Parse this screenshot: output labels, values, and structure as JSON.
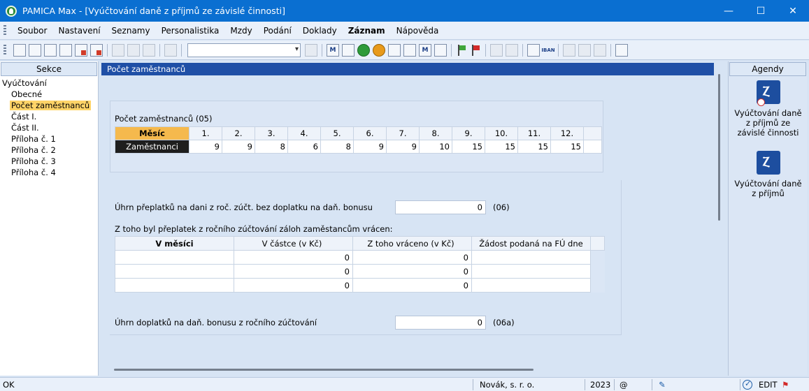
{
  "window": {
    "title": "PAMICA Max - [Vyúčtování daně z příjmů ze závislé činnosti]",
    "minimize": "—",
    "maximize": "☐",
    "close": "✕"
  },
  "menu": [
    {
      "label": "Soubor"
    },
    {
      "label": "Nastavení"
    },
    {
      "label": "Seznamy"
    },
    {
      "label": "Personalistika"
    },
    {
      "label": "Mzdy"
    },
    {
      "label": "Podání"
    },
    {
      "label": "Doklady"
    },
    {
      "label": "Záznam"
    },
    {
      "label": "Nápověda"
    }
  ],
  "toolbar": {
    "iban_label": "IBAN",
    "combo_value": ""
  },
  "left_panel": {
    "header": "Sekce",
    "items": [
      "Vyúčtování",
      "Obecné",
      "Počet zaměstnanců",
      "Část I.",
      "Část II.",
      "Příloha č. 1",
      "Příloha č. 2",
      "Příloha č. 3",
      "Příloha č. 4"
    ],
    "selected_index": 2
  },
  "main": {
    "header": "Počet zaměstnanců",
    "employees_label": "Počet zaměstnanců (05)",
    "month_header": "Měsíc",
    "months": [
      "1.",
      "2.",
      "3.",
      "4.",
      "5.",
      "6.",
      "7.",
      "8.",
      "9.",
      "10.",
      "11.",
      "12."
    ],
    "row_label": "Zaměstnanci",
    "employee_counts": [
      "9",
      "9",
      "8",
      "6",
      "8",
      "9",
      "9",
      "10",
      "15",
      "15",
      "15",
      "15"
    ],
    "overpayment_label": "Úhrn přeplatků na dani z roč. zúčt. bez doplatku na daň. bonusu",
    "overpayment_value": "0",
    "overpayment_code": "(06)",
    "refund_label": "Z toho byl přeplatek z ročního zúčtování záloh zaměstancům vrácen:",
    "refund_headers": [
      "V měsíci",
      "V částce (v Kč)",
      "Z toho vráceno (v Kč)",
      "Žádost podaná na FÚ dne"
    ],
    "refund_rows": [
      [
        "",
        "0",
        "0",
        ""
      ],
      [
        "",
        "0",
        "0",
        ""
      ],
      [
        "",
        "0",
        "0",
        ""
      ]
    ],
    "bonus_label": "Úhrn doplatků na daň. bonusu z ročního zúčtování",
    "bonus_value": "0",
    "bonus_code": "(06a)"
  },
  "right_panel": {
    "header": "Agendy",
    "items": [
      {
        "label": "Vyúčtování daně z příjmů ze závislé činnosti"
      },
      {
        "label": "Vyúčtování daně z příjmů"
      }
    ]
  },
  "status": {
    "left": "OK",
    "company": "Novák, s. r. o.",
    "year": "2023",
    "at": "@",
    "mode": "EDIT"
  },
  "colors": {
    "titlebar": "#0a6fd1",
    "panel_header": "#1f4fa6",
    "selected": "#ffd468",
    "month_header": "#f5b94d"
  }
}
